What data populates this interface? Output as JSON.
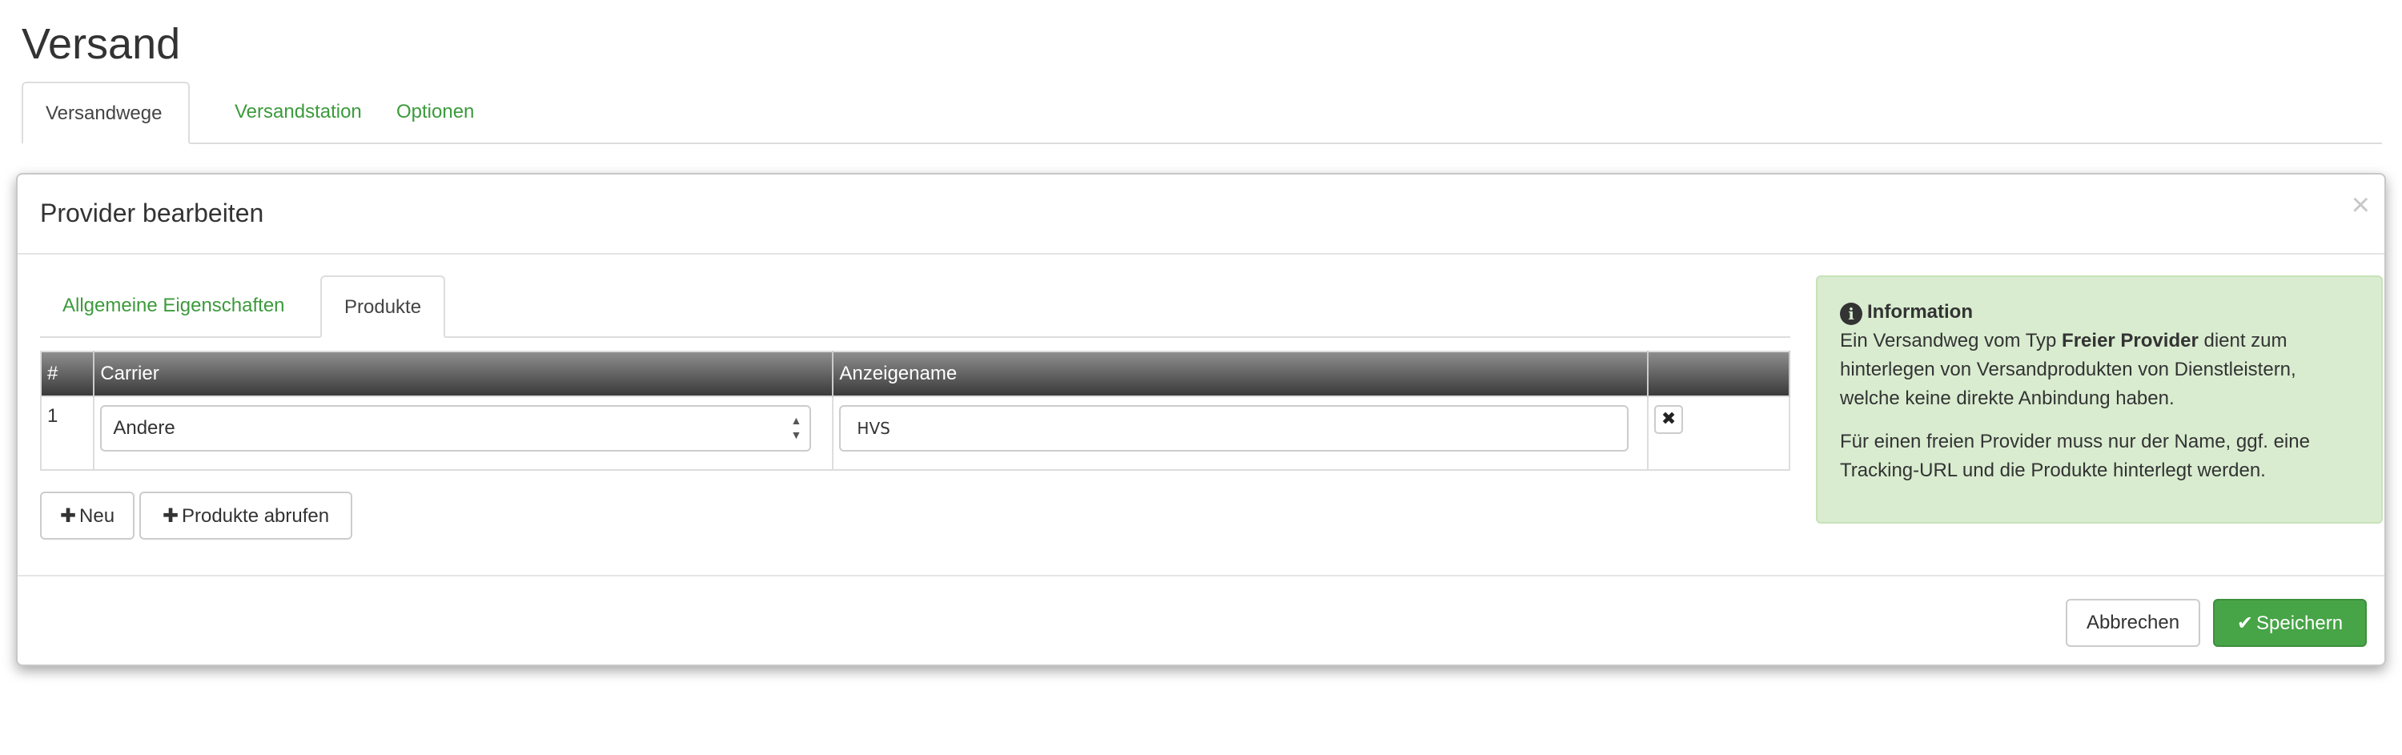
{
  "page": {
    "title": "Versand"
  },
  "top_tabs": [
    {
      "label": "Versandwege",
      "active": true
    },
    {
      "label": "Versandstation",
      "active": false
    },
    {
      "label": "Optionen",
      "active": false
    }
  ],
  "modal": {
    "title": "Provider bearbeiten",
    "close_glyph": "×",
    "tabs": [
      {
        "label": "Allgemeine Eigenschaften",
        "active": false
      },
      {
        "label": "Produkte",
        "active": true
      }
    ],
    "table": {
      "headers": [
        "#",
        "Carrier",
        "Anzeigename",
        ""
      ],
      "rows": [
        {
          "index": "1",
          "carrier": "Andere",
          "display_name": "HVS"
        }
      ]
    },
    "buttons": {
      "new": "Neu",
      "fetch_products": "Produkte abrufen"
    },
    "info": {
      "title": "Information",
      "p1_before": "Ein Versandweg vom Typ ",
      "p1_bold": "Freier Provider",
      "p1_after": " dient zum hinterlegen von Versandprodukten von Dienstleistern, welche keine direkte Anbindung haben.",
      "p2": "Für einen freien Provider muss nur der Name, ggf. eine Tracking-URL und die Produkte hinterlegt werden."
    },
    "footer": {
      "cancel": "Abbrechen",
      "save": "Speichern"
    }
  },
  "icons": {
    "plus": "plus-icon",
    "check": "check-icon",
    "info": "info-circle-icon",
    "remove": "times-icon",
    "close": "close-icon",
    "sort": "select-arrows-icon"
  },
  "colors": {
    "accent_green": "#47a447",
    "link_green": "#3c9a3c",
    "info_bg": "#d9ecd0"
  }
}
